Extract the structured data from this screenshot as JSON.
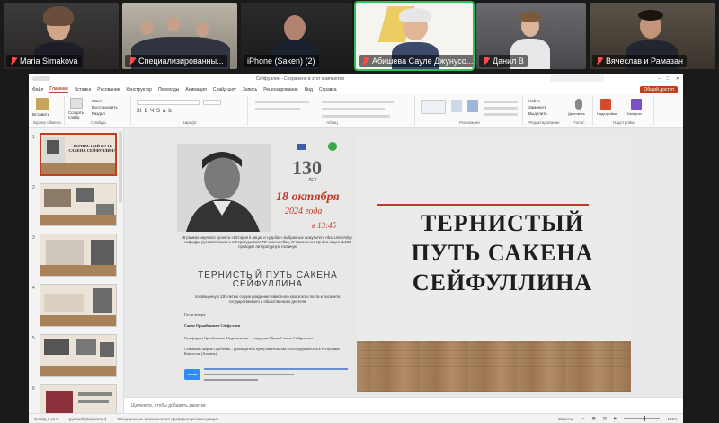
{
  "participants": [
    {
      "name": "Maria Simakova",
      "muted": true
    },
    {
      "name": "Специализированны...",
      "muted": true
    },
    {
      "name": "iPhone (Saken) (2)",
      "muted": false
    },
    {
      "name": "Абишева Сауле Джунусо...",
      "muted": true,
      "active": true
    },
    {
      "name": "Данил В",
      "muted": true
    },
    {
      "name": "Вячеслав и Рамазан",
      "muted": true
    }
  ],
  "ppt": {
    "window_title": "Сейфуллин - Сохранено в этот компьютер",
    "tabs": [
      "Файл",
      "Главная",
      "Вставка",
      "Рисование",
      "Конструктор",
      "Переходы",
      "Анимация",
      "Слайд-шоу",
      "Запись",
      "Рецензирование",
      "Вид",
      "Справка"
    ],
    "active_tab": "Главная",
    "share_label": "Общий доступ",
    "ribbon_groups": [
      "Буфер обмена",
      "Слайды",
      "Шрифт",
      "Абзац",
      "Рисование",
      "Редактирование",
      "Голос",
      "Надстройки"
    ],
    "ribbon_buttons": {
      "paste": "Вставить",
      "create_slide": "Создать слайд",
      "macro": "Макет",
      "restore": "Восстановить",
      "section": "Раздел",
      "find": "Найти",
      "replace": "Заменить",
      "select": "Выделить",
      "dictate": "Диктовать",
      "addins": "Надстройки",
      "designer": "Designer"
    },
    "thumbnails": [
      {
        "num": "1",
        "title": "ТЕРНИСТЫЙ ПУТЬ САКЕНА СЕЙФУЛЛИНА"
      },
      {
        "num": "2",
        "title": ""
      },
      {
        "num": "3",
        "title": ""
      },
      {
        "num": "4",
        "title": ""
      },
      {
        "num": "5",
        "title": ""
      },
      {
        "num": "6",
        "title": ""
      }
    ],
    "slide": {
      "title": "ТЕРНИСТЫЙ ПУТЬ САКЕНА СЕЙФУЛЛИНА",
      "poster": {
        "years": "130",
        "years_label": "ЛЕТ",
        "date": "18 октября",
        "year": "2024 года",
        "time": "в 13:45",
        "intro": "В рамках научного проекта «История в лицах и судьбах» выбранных факультета Abai University» кафедры русского языка и литературы КазНПУ имени Абая, СЧ школы-интерната лицея №165 проводят литературную гостиную",
        "headline": "ТЕРНИСТЫЙ ПУТЬ САКЕНА СЕЙФУЛЛИНА",
        "dedication": "посвященную 130-летию со дня рождения известного казахского поэта и писателя, государственного и общественного деятеля.",
        "guests_label": "Гости вечера:",
        "guest1": "Сакен Орынбекович Сейфуллин",
        "guest2": "Гульфируза Оралбековна Абдрахманова – сотрудник Музея Сакена Сейфуллина",
        "guest3": "Степанова Мария Сергеевна – руководитель представительства Россотрудничества в Республике Казахстан (Алматы)",
        "zoom": "zoom"
      }
    },
    "notes_placeholder": "Щелкните, чтобы добавить заметки",
    "status": {
      "slide_info": "Слайд 1 из 6",
      "language": "русский (Казахстан)",
      "accessibility": "Специальные возможности: проверьте рекомендации",
      "notes": "Заметки",
      "zoom": "109%"
    }
  }
}
